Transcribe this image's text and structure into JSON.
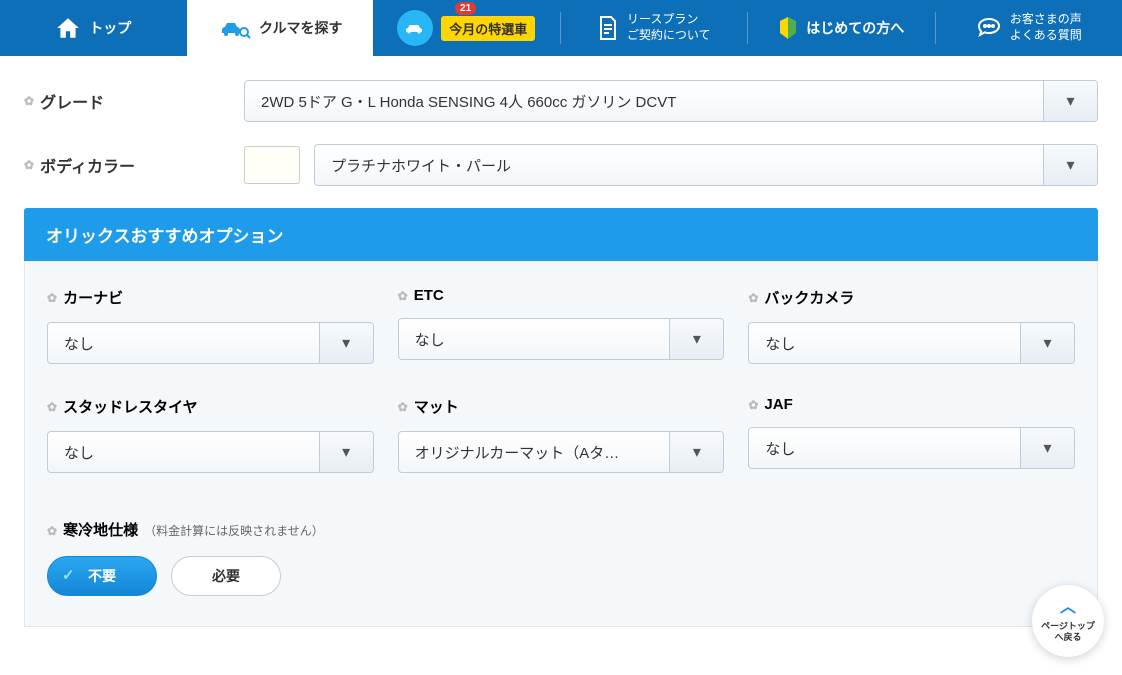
{
  "nav": {
    "top": "トップ",
    "search": "クルマを探す",
    "special": "今月の特選車",
    "special_badge": "21",
    "lease": {
      "line1": "リースプラン",
      "line2": "ご契約について"
    },
    "beginner": "はじめての方へ",
    "voice": {
      "line1": "お客さまの声",
      "line2": "よくある質問"
    }
  },
  "form": {
    "grade": {
      "label": "グレード",
      "value": "2WD 5ドア G・L Honda SENSING 4人 660cc ガソリン DCVT"
    },
    "bodyColor": {
      "label": "ボディカラー",
      "value": "プラチナホワイト・パール",
      "swatch": "#fffef7"
    }
  },
  "options": {
    "header": "オリックスおすすめオプション",
    "items": [
      {
        "label": "カーナビ",
        "value": "なし"
      },
      {
        "label": "ETC",
        "value": "なし"
      },
      {
        "label": "バックカメラ",
        "value": "なし"
      },
      {
        "label": "スタッドレスタイヤ",
        "value": "なし"
      },
      {
        "label": "マット",
        "value": "オリジナルカーマット（Aタ…"
      },
      {
        "label": "JAF",
        "value": "なし"
      }
    ]
  },
  "cold": {
    "label": "寒冷地仕様",
    "note": "（料金計算には反映されません）",
    "no": "不要",
    "yes": "必要"
  },
  "pagetop": {
    "line1": "ページトップ",
    "line2": "へ戻る"
  }
}
